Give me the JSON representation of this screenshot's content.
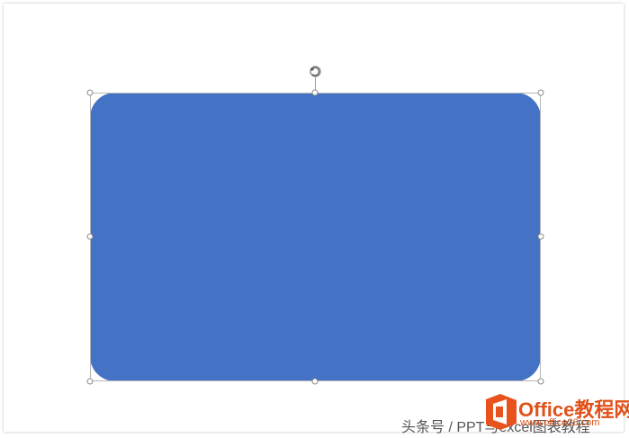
{
  "slide": {
    "shape": {
      "kind": "rounded-rectangle",
      "fill_color": "#4472c4",
      "selected": true
    },
    "rotate_handle_icon": "rotate-icon"
  },
  "colors": {
    "shape_fill": "#4472c4",
    "watermark_brand": "#e0521a"
  },
  "watermark": {
    "attribution": "头条号 / PPT与excel图表教程",
    "brand": "Office教程网",
    "url": "www.office26.com",
    "logo_icon": "office-logo-icon"
  }
}
